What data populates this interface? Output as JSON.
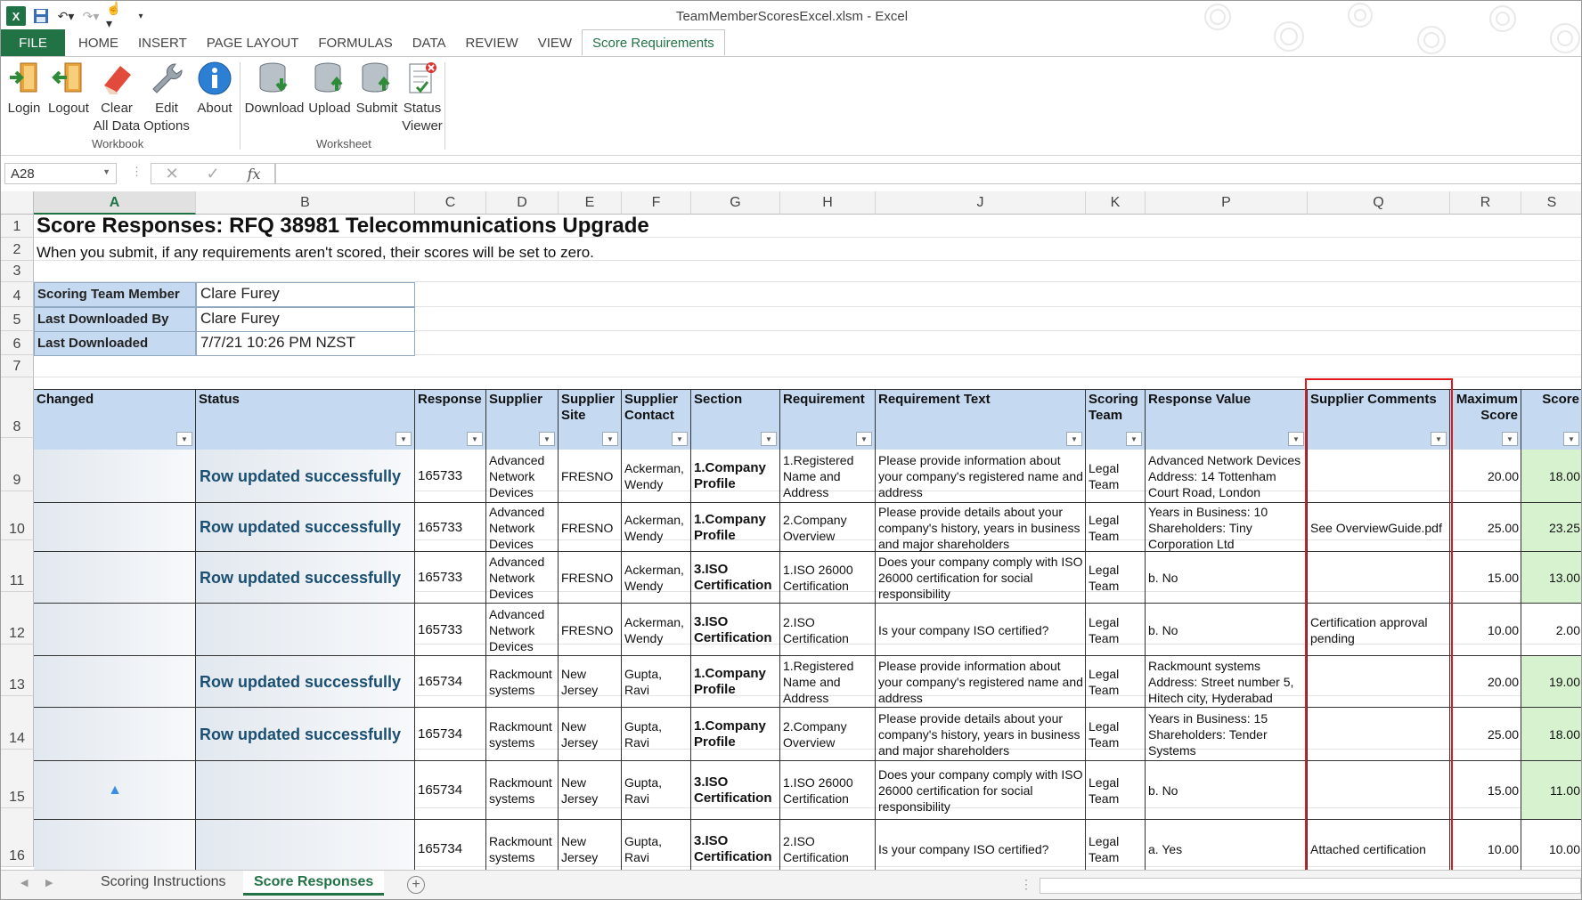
{
  "window": {
    "title": "TeamMemberScoresExcel.xlsm - Excel"
  },
  "ribbon_tabs": [
    "FILE",
    "HOME",
    "INSERT",
    "PAGE LAYOUT",
    "FORMULAS",
    "DATA",
    "REVIEW",
    "VIEW",
    "Score Requirements"
  ],
  "ribbon": {
    "workbook_group": "Workbook",
    "worksheet_group": "Worksheet",
    "buttons": {
      "login": "Login",
      "logout": "Logout",
      "clear_1": "Clear",
      "clear_2": "All Data",
      "edit_1": "Edit",
      "edit_2": "Options",
      "about": "About",
      "download": "Download",
      "upload": "Upload",
      "submit": "Submit",
      "status_1": "Status",
      "status_2": "Viewer"
    }
  },
  "formula_bar": {
    "name_box": "A28",
    "fx": "fx",
    "formula": ""
  },
  "columns": [
    "A",
    "B",
    "C",
    "D",
    "E",
    "F",
    "G",
    "H",
    "J",
    "K",
    "P",
    "Q",
    "R",
    "S"
  ],
  "rows": [
    "1",
    "2",
    "3",
    "4",
    "5",
    "6",
    "7",
    "8",
    "9",
    "10",
    "11",
    "12",
    "13",
    "14",
    "15",
    "16"
  ],
  "sheet": {
    "title": "Score Responses: RFQ 38981 Telecommunications Upgrade",
    "subtitle": "When you submit, if any requirements aren't scored, their scores will be set to zero.",
    "info": [
      {
        "label": "Scoring Team Member",
        "value": "Clare Furey"
      },
      {
        "label": "Last Downloaded By",
        "value": "Clare Furey"
      },
      {
        "label": "Last Downloaded",
        "value": "7/7/21 10:26 PM NZST"
      }
    ],
    "headers": {
      "changed": "Changed",
      "status": "Status",
      "response": "Response",
      "supplier": "Supplier",
      "site": "Supplier Site",
      "contact": "Supplier Contact",
      "section": "Section",
      "requirement": "Requirement",
      "req_text": "Requirement Text",
      "team": "Scoring Team",
      "value": "Response Value",
      "comments": "Supplier Comments",
      "max": "Maximum Score",
      "score": "Score"
    },
    "data_rows": [
      {
        "changed": "",
        "status": "Row updated successfully",
        "response": "165733",
        "supplier": "Advanced Network Devices",
        "site": "FRESNO",
        "contact": "Ackerman, Wendy",
        "section": "1.Company Profile",
        "requirement": "1.Registered Name and Address",
        "req_text": "Please provide information about your company's registered name and address",
        "team": "Legal Team",
        "value": "Advanced Network Devices Address: 14 Tottenham Court Road, London",
        "comments": "",
        "max": "20.00",
        "score": "18.00",
        "green": true
      },
      {
        "changed": "",
        "status": "Row updated successfully",
        "response": "165733",
        "supplier": "Advanced Network Devices",
        "site": "FRESNO",
        "contact": "Ackerman, Wendy",
        "section": "1.Company Profile",
        "requirement": "2.Company Overview",
        "req_text": "Please provide details about your company's history, years in business and major shareholders",
        "team": "Legal Team",
        "value": "Years in Business: 10 Shareholders: Tiny Corporation Ltd",
        "comments": "See OverviewGuide.pdf",
        "max": "25.00",
        "score": "23.25",
        "green": true
      },
      {
        "changed": "",
        "status": "Row updated successfully",
        "response": "165733",
        "supplier": "Advanced Network Devices",
        "site": "FRESNO",
        "contact": "Ackerman, Wendy",
        "section": "3.ISO Certification",
        "requirement": "1.ISO 26000 Certification",
        "req_text": "Does your company comply with ISO 26000 certification for social responsibility",
        "team": "Legal Team",
        "value": "b. No",
        "comments": "",
        "max": "15.00",
        "score": "13.00",
        "green": true
      },
      {
        "changed": "",
        "status": "",
        "response": "165733",
        "supplier": "Advanced Network Devices",
        "site": "FRESNO",
        "contact": "Ackerman, Wendy",
        "section": "3.ISO Certification",
        "requirement": "2.ISO Certification",
        "req_text": "Is your company ISO certified?",
        "team": "Legal Team",
        "value": "b. No",
        "comments": "Certification approval pending",
        "max": "10.00",
        "score": "2.00",
        "green": false
      },
      {
        "changed": "",
        "status": "Row updated successfully",
        "response": "165734",
        "supplier": "Rackmount systems",
        "site": "New Jersey",
        "contact": "Gupta, Ravi",
        "section": "1.Company Profile",
        "requirement": "1.Registered Name and Address",
        "req_text": "Please provide information about your company's registered name and address",
        "team": "Legal Team",
        "value": "Rackmount systems Address: Street number 5, Hitech city, Hyderabad",
        "comments": "",
        "max": "20.00",
        "score": "19.00",
        "green": true
      },
      {
        "changed": "",
        "status": "Row updated successfully",
        "response": "165734",
        "supplier": "Rackmount systems",
        "site": "New Jersey",
        "contact": "Gupta, Ravi",
        "section": "1.Company Profile",
        "requirement": "2.Company Overview",
        "req_text": "Please provide details about your company's history, years in business and major shareholders",
        "team": "Legal Team",
        "value": "Years in Business: 15 Shareholders: Tender Systems",
        "comments": "",
        "max": "25.00",
        "score": "18.00",
        "green": true
      },
      {
        "changed": "▲",
        "status": "",
        "response": "165734",
        "supplier": "Rackmount systems",
        "site": "New Jersey",
        "contact": "Gupta, Ravi",
        "section": "3.ISO Certification",
        "requirement": "1.ISO 26000 Certification",
        "req_text": "Does your company comply with ISO 26000 certification for social responsibility",
        "team": "Legal Team",
        "value": "b. No",
        "comments": "",
        "max": "15.00",
        "score": "11.00",
        "green": true
      },
      {
        "changed": "",
        "status": "",
        "response": "165734",
        "supplier": "Rackmount systems",
        "site": "New Jersey",
        "contact": "Gupta, Ravi",
        "section": "3.ISO Certification",
        "requirement": "2.ISO Certification",
        "req_text": "Is your company ISO certified?",
        "team": "Legal Team",
        "value": "a. Yes",
        "comments": "Attached certification",
        "max": "10.00",
        "score": "10.00",
        "green": false
      }
    ]
  },
  "sheet_tabs": [
    "Scoring Instructions",
    "Score Responses"
  ],
  "colors": {
    "excel_green": "#217346",
    "header_blue": "#c5d9f1",
    "score_green": "#d6f2cf",
    "highlight_red": "#e0191e",
    "status_text": "#1b4f72"
  }
}
